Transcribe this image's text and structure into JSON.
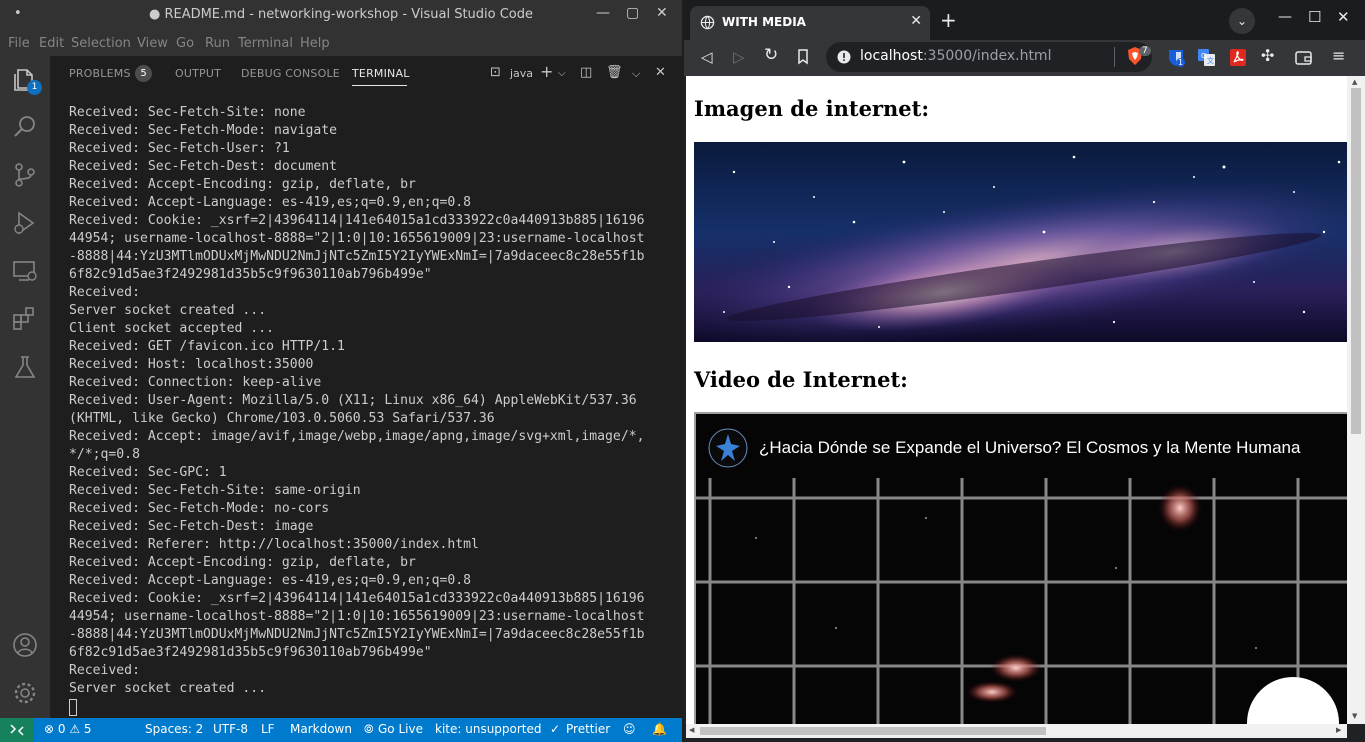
{
  "vscode": {
    "window_title": "● README.md - networking-workshop - Visual Studio Code",
    "menu": [
      "File",
      "Edit",
      "Selection",
      "View",
      "Go",
      "Run",
      "Terminal",
      "Help"
    ],
    "explorer_badge": "1",
    "panel_tabs": {
      "problems": "PROBLEMS",
      "problems_count": "5",
      "output": "OUTPUT",
      "debug_console": "DEBUG CONSOLE",
      "terminal": "TERMINAL"
    },
    "terminal_shell": "java",
    "terminal_lines": [
      "Received: Sec-Fetch-Site: none",
      "Received: Sec-Fetch-Mode: navigate",
      "Received: Sec-Fetch-User: ?1",
      "Received: Sec-Fetch-Dest: document",
      "Received: Accept-Encoding: gzip, deflate, br",
      "Received: Accept-Language: es-419,es;q=0.9,en;q=0.8",
      "Received: Cookie: _xsrf=2|43964114|141e64015a1cd333922c0a440913b885|16196",
      "44954; username-localhost-8888=\"2|1:0|10:1655619009|23:username-localhost",
      "-8888|44:YzU3MTlmODUxMjMwNDU2NmJjNTc5ZmI5Y2IyYWExNmI=|7a9daceec8c28e55f1b",
      "6f82c91d5ae3f2492981d35b5c9f9630110ab796b499e\"",
      "Received:",
      "Server socket created ...",
      "Client socket accepted ...",
      "Received: GET /favicon.ico HTTP/1.1",
      "Received: Host: localhost:35000",
      "Received: Connection: keep-alive",
      "Received: User-Agent: Mozilla/5.0 (X11; Linux x86_64) AppleWebKit/537.36",
      "(KHTML, like Gecko) Chrome/103.0.5060.53 Safari/537.36",
      "Received: Accept: image/avif,image/webp,image/apng,image/svg+xml,image/*,",
      "*/*;q=0.8",
      "Received: Sec-GPC: 1",
      "Received: Sec-Fetch-Site: same-origin",
      "Received: Sec-Fetch-Mode: no-cors",
      "Received: Sec-Fetch-Dest: image",
      "Received: Referer: http://localhost:35000/index.html",
      "Received: Accept-Encoding: gzip, deflate, br",
      "Received: Accept-Language: es-419,es;q=0.9,en;q=0.8",
      "Received: Cookie: _xsrf=2|43964114|141e64015a1cd333922c0a440913b885|16196",
      "44954; username-localhost-8888=\"2|1:0|10:1655619009|23:username-localhost",
      "-8888|44:YzU3MTlmODUxMjMwNDU2NmJjNTc5ZmI5Y2IyYWExNmI=|7a9daceec8c28e55f1b",
      "6f82c91d5ae3f2492981d35b5c9f9630110ab796b499e\"",
      "Received:",
      "Server socket created ..."
    ],
    "status": {
      "problems": "⊗ 0 ⚠ 5",
      "spaces": "Spaces: 2",
      "encoding": "UTF-8",
      "eol": "LF",
      "language": "Markdown",
      "go_live": "Go Live",
      "kite": "kite: unsupported",
      "prettier": "Prettier"
    },
    "colors": {
      "statusbar": "#007acc",
      "remote": "#16825d",
      "badge": "#0e70c0"
    }
  },
  "browser": {
    "tab_title": "WITH MEDIA",
    "url_host": "localhost",
    "url_rest": ":35000/index.html",
    "brave_badge": "7",
    "ext_badge": "1",
    "page": {
      "heading_image": "Imagen de internet:",
      "heading_video": "Video de Internet:",
      "video_title": "¿Hacia Dónde se Expande el Universo? El Cosmos y la Mente Humana"
    }
  }
}
